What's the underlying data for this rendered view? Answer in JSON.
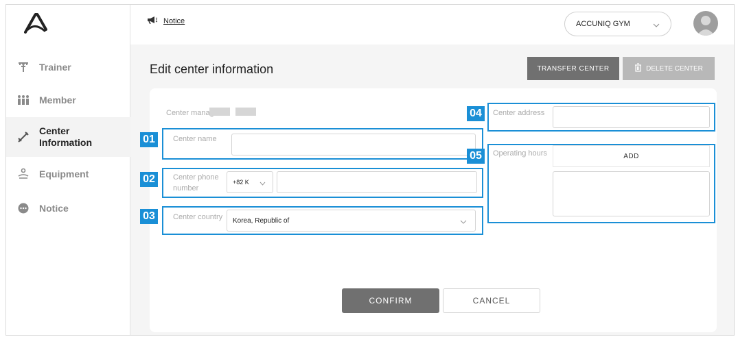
{
  "sidebar": {
    "items": [
      {
        "label": "Trainer",
        "icon": "trainer-icon"
      },
      {
        "label": "Member",
        "icon": "member-icon"
      },
      {
        "label": "Center",
        "label2": "Information",
        "icon": "center-information-icon",
        "active": true
      },
      {
        "label": "Equipment",
        "icon": "equipment-icon"
      },
      {
        "label": "Notice",
        "icon": "notice-icon"
      }
    ]
  },
  "topbar": {
    "notice_label": "Notice",
    "gym_selected": "ACCUNIQ GYM"
  },
  "page": {
    "title": "Edit center information",
    "transfer_label": "TRANSFER CENTER",
    "delete_label": "DELETE CENTER"
  },
  "form": {
    "manager_label": "Center manager",
    "name_label": "Center name",
    "name_value": "",
    "phone_label_1": "Center phone",
    "phone_label_2": "number",
    "phone_code": "+82 K",
    "phone_value": "",
    "country_label": "Center country",
    "country_value": "Korea, Republic of",
    "address_label": "Center address",
    "address_value": "",
    "hours_label": "Operating hours",
    "add_label": "ADD",
    "confirm_label": "CONFIRM",
    "cancel_label": "CANCEL"
  },
  "callouts": {
    "n1": "01",
    "n2": "02",
    "n3": "03",
    "n4": "04",
    "n5": "05"
  },
  "colors": {
    "highlight": "#1a8fd6",
    "primary_button": "#707070",
    "disabled_button": "#b8b8b8"
  }
}
